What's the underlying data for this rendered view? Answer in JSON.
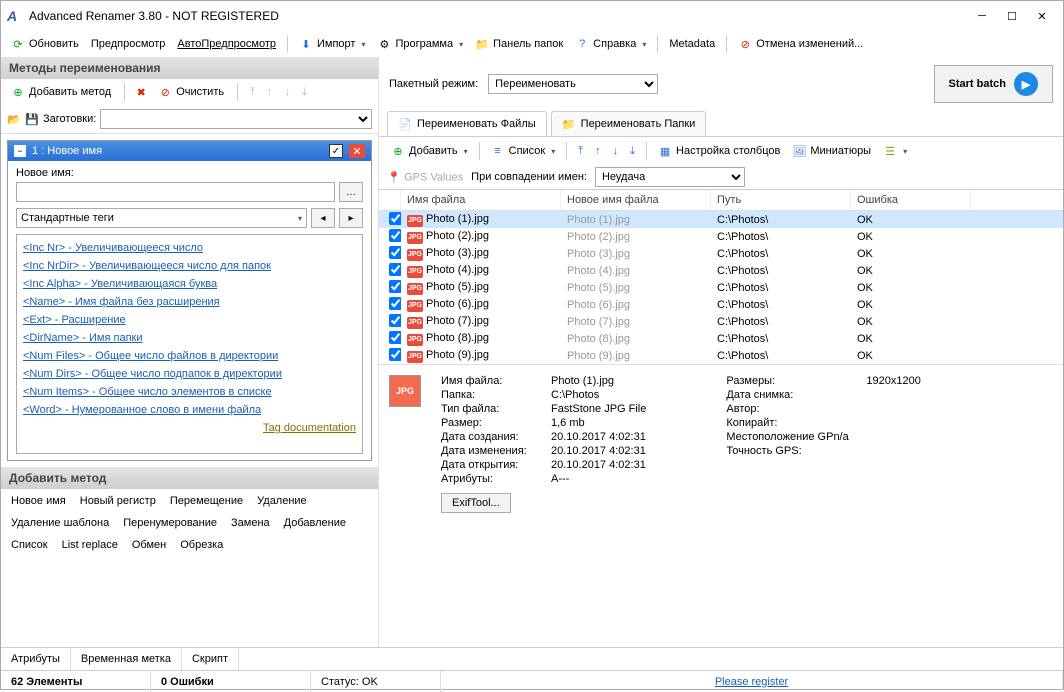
{
  "title": "Advanced Renamer 3.80 - NOT REGISTERED",
  "main_toolbar": {
    "refresh": "Обновить",
    "preview": "Предпросмотр",
    "auto_preview": "АвтоПредпросмотр",
    "import": "Импорт",
    "program": "Программа",
    "folder_panel": "Панель папок",
    "help": "Справка",
    "metadata": "Metadata",
    "undo": "Отмена изменений..."
  },
  "left": {
    "methods_header": "Методы переименования",
    "add_method": "Добавить метод",
    "clear": "Очистить",
    "presets_label": "Заготовки:",
    "method_title": "1 : Новое имя",
    "new_name_label": "Новое имя:",
    "std_tags": "Стандартные теги",
    "tags": [
      "<Inc Nr> - Увеличивающееся число",
      "<Inc NrDir> - Увеличивающееся число для папок",
      "<Inc Alpha> - Увеличивающаяся буква",
      "<Name> - Имя файла без расширения",
      "<Ext> - Расширение",
      "<DirName> - Имя папки",
      "<Num Files> - Общее число файлов в директории",
      "<Num Dirs> - Общее число подпапок в директории",
      "<Num Items> - Общее число элементов в списке",
      "<Word> - Нумерованное слово в имени файла"
    ],
    "tag_doc": "Tag documentation",
    "add_method_header": "Добавить метод",
    "add_methods": [
      "Новое имя",
      "Новый регистр",
      "Перемещение",
      "Удаление",
      "Удаление шаблона",
      "Перенумерование",
      "Замена",
      "Добавление",
      "Список",
      "List replace",
      "Обмен",
      "Обрезка"
    ],
    "bottom_tabs": [
      "Атрибуты",
      "Временная метка",
      "Скрипт"
    ]
  },
  "right": {
    "batch_mode_label": "Пакетный режим:",
    "batch_mode_value": "Переименовать",
    "start_batch": "Start batch",
    "tab_files": "Переименовать Файлы",
    "tab_folders": "Переименовать Папки",
    "tb_add": "Добавить",
    "tb_list": "Список",
    "tb_columns": "Настройка столбцов",
    "tb_thumbs": "Миниатюры",
    "gps_values": "GPS Values",
    "name_collision_label": "При совпадении имен:",
    "name_collision_value": "Неудача",
    "cols": {
      "name": "Имя файла",
      "newname": "Новое имя файла",
      "path": "Путь",
      "error": "Ошибка"
    },
    "rows": [
      {
        "name": "Photo (1).jpg",
        "new": "Photo (1).jpg",
        "path": "C:\\Photos\\",
        "err": "OK",
        "sel": true
      },
      {
        "name": "Photo (2).jpg",
        "new": "Photo (2).jpg",
        "path": "C:\\Photos\\",
        "err": "OK"
      },
      {
        "name": "Photo (3).jpg",
        "new": "Photo (3).jpg",
        "path": "C:\\Photos\\",
        "err": "OK"
      },
      {
        "name": "Photo (4).jpg",
        "new": "Photo (4).jpg",
        "path": "C:\\Photos\\",
        "err": "OK"
      },
      {
        "name": "Photo (5).jpg",
        "new": "Photo (5).jpg",
        "path": "C:\\Photos\\",
        "err": "OK"
      },
      {
        "name": "Photo (6).jpg",
        "new": "Photo (6).jpg",
        "path": "C:\\Photos\\",
        "err": "OK"
      },
      {
        "name": "Photo (7).jpg",
        "new": "Photo (7).jpg",
        "path": "C:\\Photos\\",
        "err": "OK"
      },
      {
        "name": "Photo (8).jpg",
        "new": "Photo (8).jpg",
        "path": "C:\\Photos\\",
        "err": "OK"
      },
      {
        "name": "Photo (9).jpg",
        "new": "Photo (9).jpg",
        "path": "C:\\Photos\\",
        "err": "OK"
      }
    ],
    "details_left": [
      {
        "k": "Имя файла:",
        "v": "Photo (1).jpg"
      },
      {
        "k": "Папка:",
        "v": "C:\\Photos"
      },
      {
        "k": "Тип файла:",
        "v": "FastStone JPG File"
      },
      {
        "k": "Размер:",
        "v": "1,6 mb"
      },
      {
        "k": "Дата создания:",
        "v": "20.10.2017 4:02:31"
      },
      {
        "k": "Дата изменения:",
        "v": "20.10.2017 4:02:31"
      },
      {
        "k": "Дата открытия:",
        "v": "20.10.2017 4:02:31"
      },
      {
        "k": "Атрибуты:",
        "v": "A---"
      }
    ],
    "details_right": [
      {
        "k": "Размеры:",
        "v": "1920x1200"
      },
      {
        "k": "Дата снимка:",
        "v": ""
      },
      {
        "k": "Автор:",
        "v": ""
      },
      {
        "k": "Копирайт:",
        "v": ""
      },
      {
        "k": "Местоположение GPn/a",
        "v": ""
      },
      {
        "k": "Точность GPS:",
        "v": ""
      }
    ],
    "exif_btn": "ExifTool..."
  },
  "status": {
    "elements": "62 Элементы",
    "errors": "0 Ошибки",
    "status": "Статус: OK",
    "register": "Please register"
  }
}
